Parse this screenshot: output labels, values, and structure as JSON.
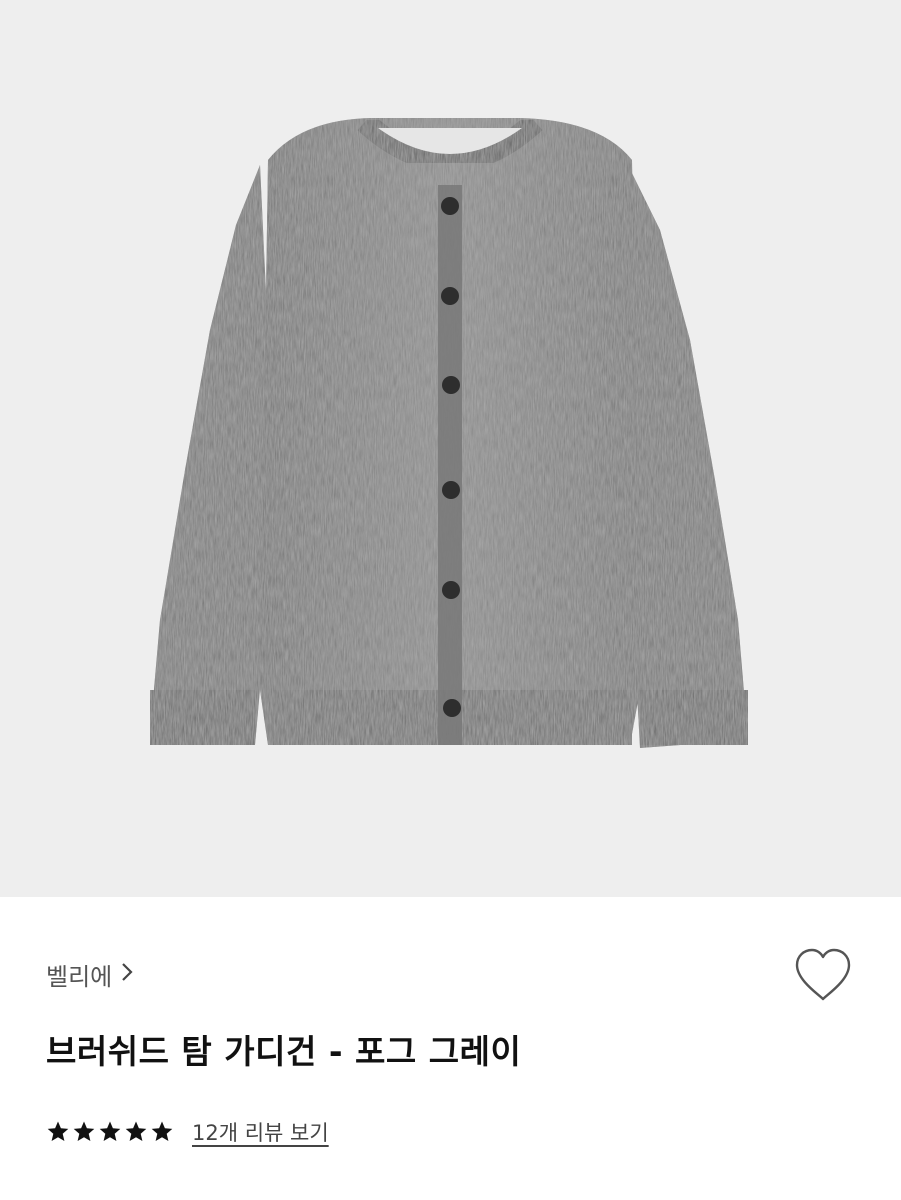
{
  "product": {
    "image_alt": "브러쉬드 탐 가디건 - 포그 그레이",
    "brand": "벨리에",
    "title": "브러쉬드 탐 가디건 - 포그 그레이",
    "rating": 5,
    "rating_max": 5,
    "review_label": "12개 리뷰 보기"
  },
  "icons": {
    "brand_chevron": "chevron-right-icon",
    "wishlist": "heart-outline-icon",
    "star": "star-filled-icon"
  },
  "colors": {
    "image_bg": "#eeeeee",
    "sweater": "#7d7d7d",
    "star": "#111111",
    "heart_stroke": "#555555"
  }
}
